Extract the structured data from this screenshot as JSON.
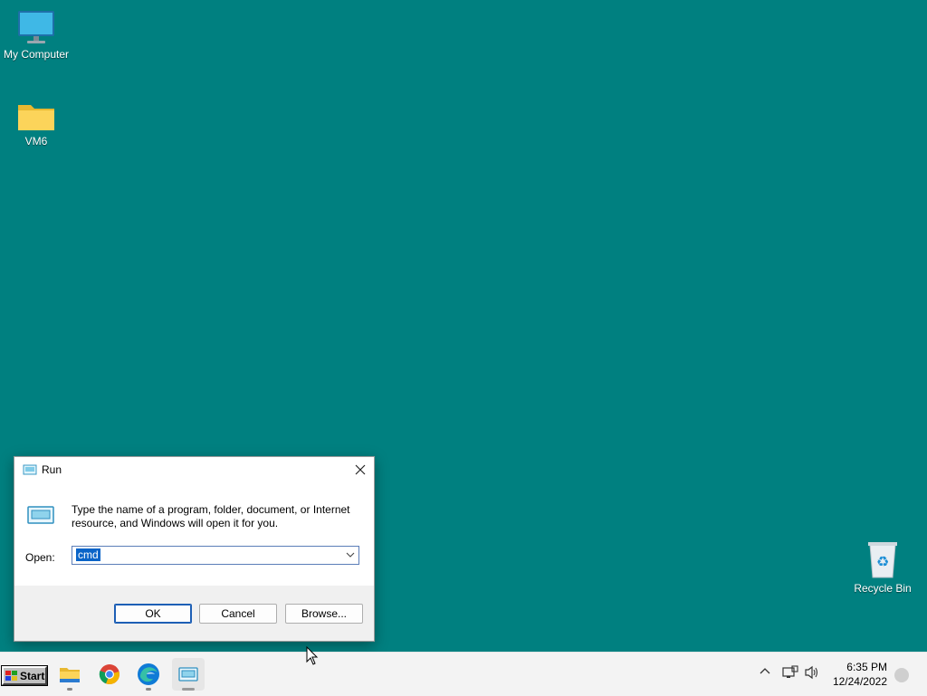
{
  "desktop": {
    "icons": [
      {
        "label": "My Computer",
        "icon": "monitor-icon"
      },
      {
        "label": "VM6",
        "icon": "folder-icon"
      },
      {
        "label": "Recycle Bin",
        "icon": "recycle-bin-icon"
      }
    ]
  },
  "run_dialog": {
    "title": "Run",
    "description": "Type the name of a program, folder, document, or Internet resource, and Windows will open it for you.",
    "open_label": "Open:",
    "open_value": "cmd",
    "buttons": {
      "ok": "OK",
      "cancel": "Cancel",
      "browse": "Browse..."
    }
  },
  "taskbar": {
    "start_label": "Start",
    "apps": [
      "file-explorer-icon",
      "chrome-icon",
      "edge-icon",
      "run-icon"
    ],
    "tray_icons": [
      "chevron-up-icon",
      "network-icon",
      "volume-icon"
    ],
    "clock": {
      "time": "6:35 PM",
      "date": "12/24/2022"
    }
  },
  "colors": {
    "desktop": "#008080",
    "accent": "#0a64c8"
  }
}
